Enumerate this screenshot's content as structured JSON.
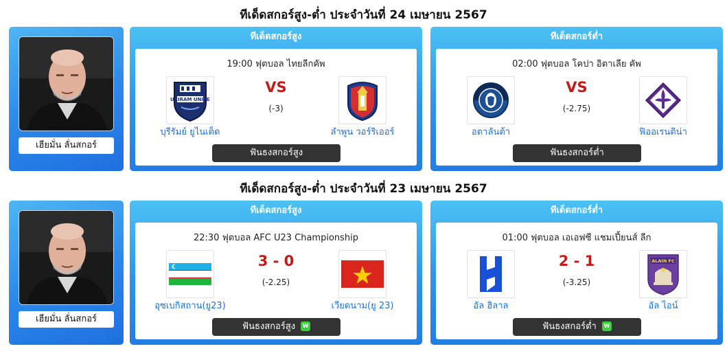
{
  "sections": [
    {
      "title": "ทีเด็ดสกอร์สูง-ต่ำ ประจำวันที่ 24 เมษายน 2567",
      "tipster": {
        "name": "เฮียมั่น ลั่นสกอร์"
      },
      "high": {
        "title": "ทีเด็ดสกอร์สูง",
        "match_info": "19:00  ฟุตบอล ไทยลีกคัพ",
        "home": "บุรีรัมย์ ยูไนเต็ด",
        "away": "ลำพูน วอร์ริเออร์",
        "center": "VS",
        "handicap": "(-3)",
        "button": "ฟันธงสกอร์สูง",
        "badge": ""
      },
      "low": {
        "title": "ทีเด็ดสกอร์ต่ำ",
        "match_info": "02:00  ฟุตบอล โคปา อิตาเลีย คัพ",
        "home": "อตาลันต้า",
        "away": "ฟิออเรนติน่า",
        "center": "VS",
        "handicap": "(-2.75)",
        "button": "ฟันธงสกอร์ต่ำ",
        "badge": ""
      }
    },
    {
      "title": "ทีเด็ดสกอร์สูง-ต่ำ ประจำวันที่ 23 เมษายน 2567",
      "tipster": {
        "name": "เฮียมั่น ลั่นสกอร์"
      },
      "high": {
        "title": "ทีเด็ดสกอร์สูง",
        "match_info": "22:30  ฟุตบอล AFC U23 Championship",
        "home": "อุซเบกิสถาน(ยู23)",
        "away": "เวียดนาม(ยู 23)",
        "center": "3 - 0",
        "handicap": "(-2.25)",
        "button": "ฟันธงสกอร์สูง",
        "badge": "W"
      },
      "low": {
        "title": "ทีเด็ดสกอร์ต่ำ",
        "match_info": "01:00  ฟุตบอล เอเอฟซี แชมเปี้ยนส์ ลีก",
        "home": "อัล ฮิลาล",
        "away": "อัล ไอน์",
        "center": "2 - 1",
        "handicap": "(-3.25)",
        "button": "ฟันธงสกอร์ต่ำ",
        "badge": "W"
      }
    }
  ],
  "logo_labels": {
    "buriram": "BURIRAM UNITED",
    "alain": "ALAIN FC"
  },
  "colors": {
    "panel_blue": "#2f93ea",
    "vs_red": "#c41a1a",
    "team_link": "#1e6fd0",
    "button_dark": "#333333",
    "win_green": "#3ad13a"
  }
}
